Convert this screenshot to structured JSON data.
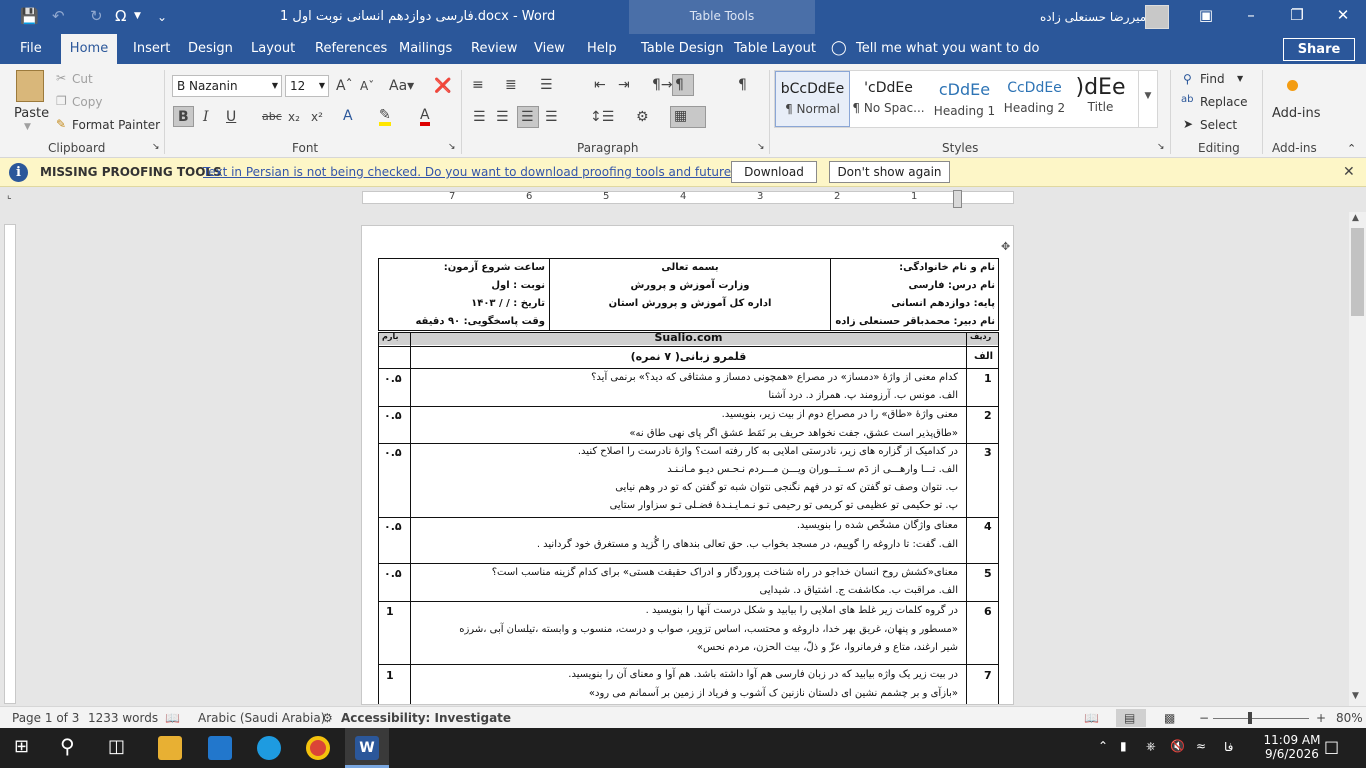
{
  "window": {
    "doc_title": "فارسی دوازدهم انسانی نوبت اول 1.docx  -  Word",
    "context_tab": "Table Tools",
    "user": "امیررضا حسنعلی زاده"
  },
  "tabs": [
    "File",
    "Home",
    "Insert",
    "Design",
    "Layout",
    "References",
    "Mailings",
    "Review",
    "View",
    "Help",
    "Table Design",
    "Table Layout"
  ],
  "tell_me": "Tell me what you want to do",
  "share": "Share",
  "ribbon": {
    "clipboard": {
      "label": "Clipboard",
      "paste": "Paste",
      "cut": "Cut",
      "copy": "Copy",
      "format_painter": "Format Painter"
    },
    "font": {
      "label": "Font",
      "name": "B Nazanin",
      "size": "12"
    },
    "paragraph": {
      "label": "Paragraph"
    },
    "styles": {
      "label": "Styles",
      "items": [
        {
          "preview": "bCcDdEe",
          "name": "¶ Normal"
        },
        {
          "preview": "'cDdEe",
          "name": "¶ No Spac..."
        },
        {
          "preview": "cDdEe",
          "name": "Heading 1"
        },
        {
          "preview": "CcDdEe",
          "name": "Heading 2"
        },
        {
          "preview": ")dEe",
          "name": "Title"
        }
      ]
    },
    "editing": {
      "label": "Editing",
      "find": "Find",
      "replace": "Replace",
      "select": "Select"
    },
    "addins": {
      "label": "Add-ins",
      "button": "Add-ins"
    }
  },
  "message_bar": {
    "title": "MISSING PROOFING TOOLS",
    "text": "Text in Persian is not being checked. Do you want to download proofing tools and future updates?",
    "download": "Download",
    "dont_show": "Don't show again"
  },
  "ruler_numbers": [
    "7",
    "6",
    "5",
    "4",
    "3",
    "2",
    "1"
  ],
  "exam": {
    "header": {
      "left": [
        "ساعت شروع آزمون:",
        "نوبت :  اول",
        "تاریخ :    /    /  ۱۴۰۳",
        "وقت پاسخگویی: ۹۰ دقیقه"
      ],
      "center": [
        "بسمه تعالی",
        "وزارت آموزش و پرورش",
        "اداره کل آموزش و پرورش استان"
      ],
      "right": [
        "نام و نام خانوادگی:",
        "نام درس: فارسی",
        "پایه: دوازدهم انسانی",
        "نام دبیر: محمدباقر حسنعلی زاده"
      ]
    },
    "col_score": "بارم",
    "col_row": "ردیف",
    "site": "Sualio.com",
    "section_letter": "الف",
    "section_title": "قلمرو زبانی( ۷ نمره)",
    "questions": [
      {
        "n": "1",
        "score": "۰.۵",
        "lines": [
          "کدام معنی از واژۀ «دمساز» در مصراع «همچونی دمساز و مشتاقی که دید؟» برنمی آید؟",
          "الف. مونس     ب. آرزومند     پ. همراز     د. درد آشنا"
        ]
      },
      {
        "n": "2",
        "score": "۰.۵",
        "lines": [
          "معنی واژۀ «طاق» را در مصراع دوم از بیت زیر، بنویسید.",
          "«طاق‌پذیر است عشق، جفت نخواهد حریف          بر نَمَط عشق اگر پای نهی طاق نه»"
        ]
      },
      {
        "n": "3",
        "score": "۰.۵",
        "lines": [
          "در کدامیک از گزاره های زیر، نادرستی املایی به کار رفته است؟ واژۀ نادرست را اصلاح کنید.",
          "الف. تـــا وارهـــی از دَم ســتـــوران          ویـــن مـــردم نـحـس دیـو مـانـنـد",
          "ب. نتوان وصف تو گفتن که تو در فهم نگنجی          نتوان شبه تو گفتن که تو در وهم نیایی",
          "پ. تو حکیمی تو عظیمی تو کریمی تو رحیمی          تـو نـمـایـنـدۀ فضـلی تـو سزاوار ستایی"
        ]
      },
      {
        "n": "4",
        "score": "۰.۵",
        "lines": [
          "معنای واژگان مشخّص شده را بنویسید.",
          "الف. گفت: تا داروغه را گوییم، در مسجد بخواب          ب. حق تعالی بندهای را گُزید و مستغرق خود گردانید ."
        ]
      },
      {
        "n": "5",
        "score": "۰.۵",
        "lines": [
          "معنای«کشش روح انسان خداجو در راه شناخت پروردگار و ادراک حقیقت هستی» برای کدام گزینه مناسب است؟",
          "الف. مراقبت     ب. مکاشفت     ج. اشتیاق     د. شیدایی"
        ]
      },
      {
        "n": "6",
        "score": "1",
        "lines": [
          "در گروه کلمات زیر غلط های املایی را بیابید و شکل درست آنها را بنویسید .",
          "«مسطور و پنهان، غریق بهر خدا، داروغه و محتسب، اساس تزویر، صواب و درست، منسوب و وابسته ،تیلسان آبی ،شرزه",
          "شیر ارغند،  متاع و فرمانروا، عزّ و ذلّ، بیت الحزن، مردم نحس»"
        ]
      },
      {
        "n": "7",
        "score": "1",
        "lines": [
          "در بیت زیر یک واژه بیابید که در زبان فارسی هم آوا داشته باشد. هم آوا و معنای آن را بنویسید.",
          "«بازآی و بر چشمم نشین ای دلستان نازنین     ک آشوب و فریاد از زمین بر آسمانم می رود»"
        ]
      }
    ]
  },
  "status": {
    "page": "Page 1 of 3",
    "words": "1233 words",
    "language": "Arabic (Saudi Arabia)",
    "accessibility": "Accessibility: Investigate",
    "zoom": "80%"
  },
  "tray": {
    "lang": "فا",
    "time": "11:09 AM",
    "date": "9/6/2026"
  }
}
